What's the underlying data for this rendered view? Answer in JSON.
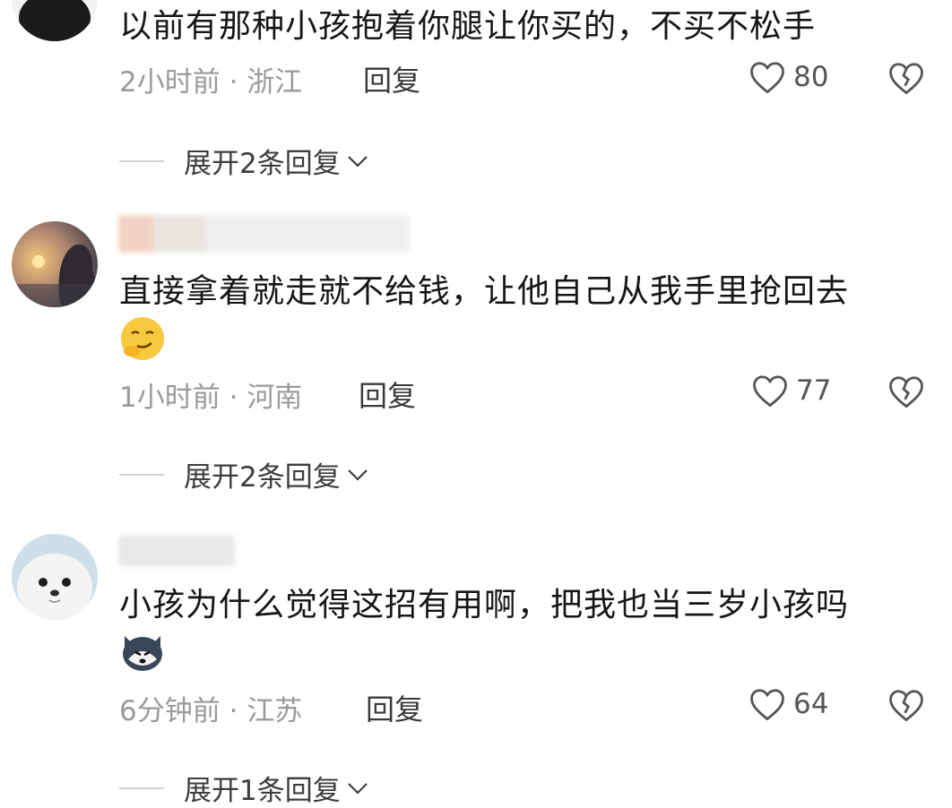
{
  "comments": [
    {
      "text": "以前有那种小孩抱着你腿让你买的，不买不松手",
      "time": "2小时前",
      "location": "浙江",
      "reply_label": "回复",
      "likes": "80",
      "expand_label": "展开2条回复"
    },
    {
      "text": "直接拿着就走就不给钱，让他自己从我手里抢回去",
      "time": "1小时前",
      "location": "河南",
      "reply_label": "回复",
      "likes": "77",
      "expand_label": "展开2条回复"
    },
    {
      "text": "小孩为什么觉得这招有用啊，把我也当三岁小孩吗",
      "time": "6分钟前",
      "location": "江苏",
      "reply_label": "回复",
      "likes": "64",
      "expand_label": "展开1条回复"
    }
  ],
  "meta_separator": "·",
  "icons": {
    "like": "heart-outline-icon",
    "dislike": "broken-heart-icon",
    "expand": "chevron-down-icon"
  },
  "colors": {
    "text": "#161616",
    "meta": "#9a9a9a",
    "icon": "#555555"
  }
}
